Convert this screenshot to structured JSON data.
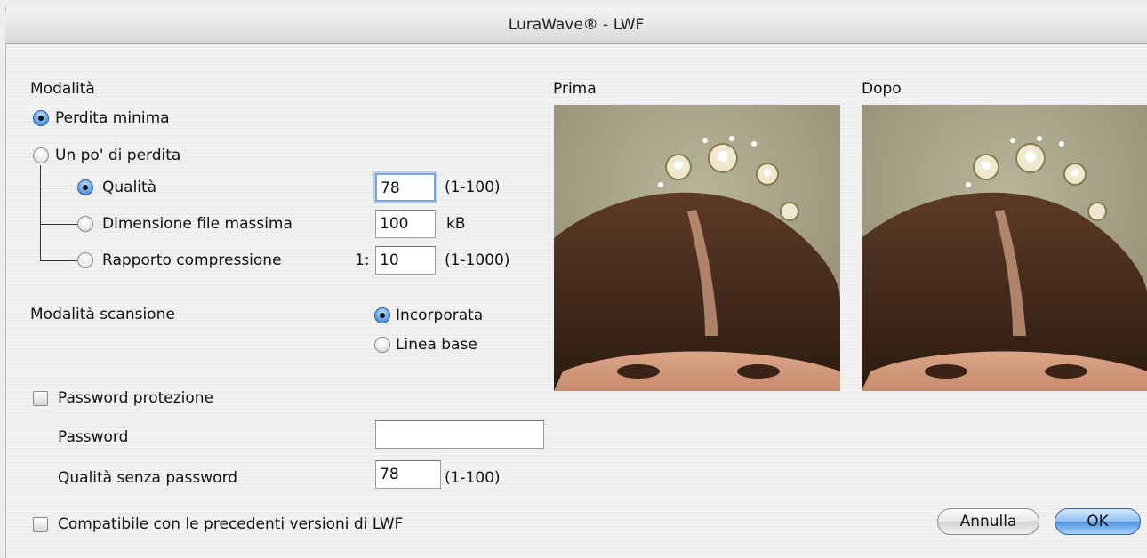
{
  "window": {
    "title": "LuraWave® - LWF"
  },
  "mode": {
    "heading": "Modalità",
    "option_minimal": "Perdita minima",
    "option_some": "Un po' di perdita",
    "sub_quality": "Qualità",
    "sub_maxsize": "Dimensione file massima",
    "sub_ratio": "Rapporto compressione",
    "quality_value": "78",
    "quality_range": "(1-100)",
    "maxsize_value": "100",
    "maxsize_unit": "kB",
    "ratio_prefix": "1:",
    "ratio_value": "10",
    "ratio_range": "(1-1000)",
    "selected": "Perdita minima",
    "sub_selected": "Qualità"
  },
  "scan": {
    "heading": "Modalità scansione",
    "option_embedded": "Incorporata",
    "option_baseline": "Linea base",
    "selected": "Incorporata"
  },
  "password": {
    "checkbox_label": "Password protezione",
    "checked": false,
    "password_label": "Password",
    "password_value": "",
    "quality_label": "Qualità senza password",
    "quality_value": "78",
    "quality_range": "(1-100)"
  },
  "compat": {
    "checkbox_label": "Compatibile con le precedenti versioni di LWF",
    "checked": false
  },
  "preview": {
    "before_label": "Prima",
    "after_label": "Dopo"
  },
  "buttons": {
    "cancel": "Annulla",
    "ok": "OK"
  },
  "colors": {
    "accent": "#4f93dd",
    "focus_ring": "#7ba7dc"
  }
}
